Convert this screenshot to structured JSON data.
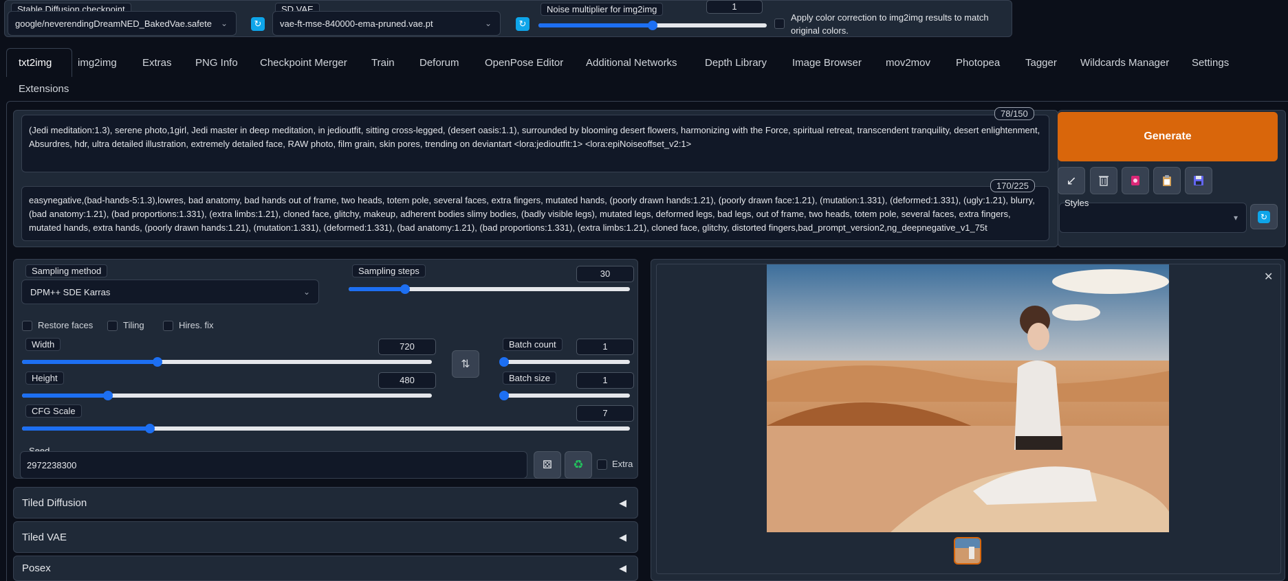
{
  "top": {
    "checkpoint": {
      "label": "Stable Diffusion checkpoint",
      "value": "google/neverendingDreamNED_BakedVae.safete"
    },
    "vae": {
      "label": "SD VAE",
      "value": "vae-ft-mse-840000-ema-pruned.vae.pt"
    },
    "noise": {
      "label": "Noise multiplier for img2img",
      "value": "1",
      "fraction": 0.5
    },
    "color_correction": {
      "label": "Apply color correction to img2img results to match original colors."
    }
  },
  "tabs": [
    "txt2img",
    "img2img",
    "Extras",
    "PNG Info",
    "Checkpoint Merger",
    "Train",
    "Deforum",
    "OpenPose Editor",
    "Additional Networks",
    "Depth Library",
    "Image Browser",
    "mov2mov",
    "Photopea",
    "Tagger",
    "Wildcards Manager",
    "Settings",
    "Extensions"
  ],
  "prompt": {
    "text": "(Jedi meditation:1.3), serene photo,1girl, Jedi master in deep meditation, in jedioutfit, sitting cross-legged, (desert oasis:1.1), surrounded by blooming desert flowers, harmonizing with the Force, spiritual retreat, transcendent tranquility, desert enlightenment, Absurdres, hdr, ultra detailed illustration, extremely detailed face, RAW photo, film grain, skin pores, trending on deviantart <lora:jedioutfit:1> <lora:epiNoiseoffset_v2:1>",
    "counter": "78/150"
  },
  "negative": {
    "text": "easynegative,(bad-hands-5:1.3),lowres, bad anatomy, bad hands out of frame, two heads, totem pole, several faces, extra fingers, mutated hands, (poorly drawn hands:1.21), (poorly drawn face:1.21), (mutation:1.331), (deformed:1.331), (ugly:1.21), blurry, (bad anatomy:1.21), (bad proportions:1.331), (extra limbs:1.21), cloned face, glitchy, makeup, adherent bodies slimy bodies, (badly visible legs), mutated legs, deformed legs, bad legs, out of frame, two heads, totem pole, several faces, extra fingers, mutated hands, extra hands, (poorly drawn hands:1.21), (mutation:1.331), (deformed:1.331), (bad anatomy:1.21), (bad proportions:1.331), (extra limbs:1.21), cloned face, glitchy, distorted fingers,bad_prompt_version2,ng_deepnegative_v1_75t",
    "counter": "170/225"
  },
  "generate_label": "Generate",
  "styles_label": "Styles",
  "sampling": {
    "label": "Sampling method",
    "value": "DPM++ SDE Karras"
  },
  "steps": {
    "label": "Sampling steps",
    "value": "30",
    "fraction": 0.2
  },
  "checks": {
    "restore": "Restore faces",
    "tiling": "Tiling",
    "hires": "Hires. fix"
  },
  "width": {
    "label": "Width",
    "value": "720",
    "fraction": 0.33
  },
  "height": {
    "label": "Height",
    "value": "480",
    "fraction": 0.21
  },
  "batch_count": {
    "label": "Batch count",
    "value": "1",
    "fraction": 0.0
  },
  "batch_size": {
    "label": "Batch size",
    "value": "1",
    "fraction": 0.0
  },
  "cfg": {
    "label": "CFG Scale",
    "value": "7",
    "fraction": 0.21
  },
  "seed": {
    "label": "Seed",
    "value": "2972238300",
    "extra": "Extra"
  },
  "accordions": [
    "Tiled Diffusion",
    "Tiled VAE",
    "Posex"
  ],
  "colors": {
    "accent": "#1d6ff2",
    "generate": "#d9660b",
    "bg": "#0b0f19"
  }
}
